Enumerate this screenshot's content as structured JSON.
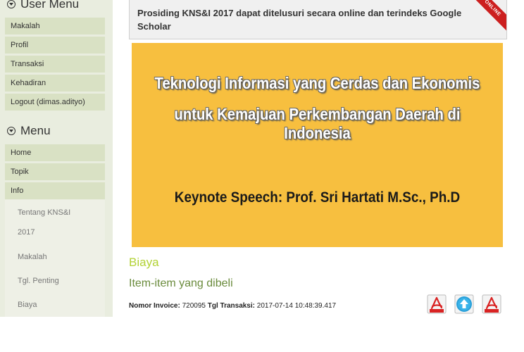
{
  "user_menu": {
    "title": "User Menu",
    "items": [
      "Makalah",
      "Profil",
      "Transaksi",
      "Kehadiran",
      "Logout (dimas.adityo)"
    ]
  },
  "menu": {
    "title": "Menu",
    "items": [
      "Home",
      "Topik",
      "Info"
    ],
    "sub_items": [
      "Tentang KNS&I",
      "2017",
      "Makalah",
      "Tgl. Penting",
      "Biaya"
    ]
  },
  "announcement": {
    "text": "Prosiding KNS&I 2017 dapat ditelusuri secara online dan terindeks Google Scholar",
    "ribbon": "ONLINE"
  },
  "banner": {
    "line1": "Teknologi Informasi yang Cerdas dan Ekonomis",
    "line2": "untuk Kemajuan Perkembangan Daerah di Indonesia",
    "keynote": "Keynote Speech: Prof. Sri Hartati M.Sc., Ph.D"
  },
  "content": {
    "section_title": "Biaya",
    "section_subtitle": "Item-item yang dibeli",
    "invoice_label": "Nomor Invoice:",
    "invoice_number": "720095",
    "date_label": "Tgl Transaksi:",
    "date_value": "2017-07-14 10:48:39.417"
  },
  "icons": [
    "pdf-icon",
    "upload-icon",
    "pdf-icon"
  ],
  "colors": {
    "sidebar_bg": "#e9eddf",
    "menu_item_bg": "#d9e1c4",
    "banner_bg": "#f7bf3f",
    "section_title": "#b2d234",
    "section_subtitle": "#6a8b3c",
    "ribbon": "#cc1f1f"
  }
}
